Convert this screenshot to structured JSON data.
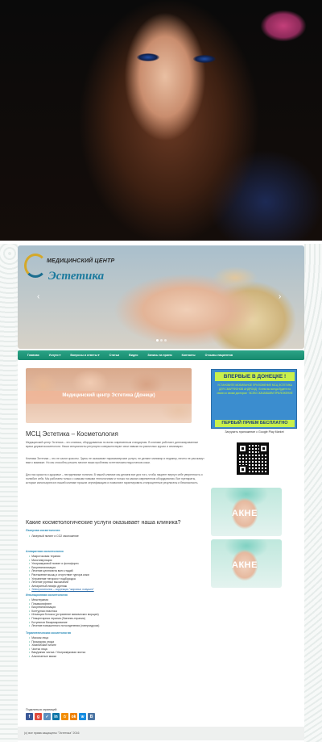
{
  "site": {
    "logo_small": "МЕДИЦИНСКИЙ ЦЕНТР",
    "logo_big": "Эстетика",
    "slider_prev": "‹",
    "slider_next": "›"
  },
  "nav": [
    "Главная",
    "Услуги ▾",
    "Вопросы и ответы ▾",
    "Статьи",
    "Видео",
    "Запись на прием",
    "Контакты",
    "Отзывы пациентов"
  ],
  "banner_text": "Медицинский центр Эстетика (Донецк)",
  "promo": {
    "top": "ВПЕРВЫЕ В ДОНЕЦКЕ !",
    "middle": "УСТАНОВИТЕ МОБИЛЬНОЕ ПРИЛОЖЕНИЕ МСЦ ЭСТЕТИКА ДЛЯ СМАРТФОНОВ АНДРОИД · В нем вы всегда будете на связи со своим доктором · ВСЕМ СКАЧАВШИМ ПРИЛОЖЕНИЕ",
    "bottom": "ПЕРВЫЙ ПРИЕМ БЕСПЛАТНО"
  },
  "app_text": "Загрузить приложение с Google Play Market",
  "acne_label": "АКНЕ",
  "main": {
    "title": "МСЦ Эстетика – Косметология",
    "para1": "Медицинский центр Эстетика – это клиника, оборудованная по всем современным стандартам. В клинике работают дипломированные врачи дерматокосметологи. Наши специалисты регулярно совершенствуют свои навыки на различных курсах и семинарах.",
    "para2": "Клиника Эстетика – это не салон красоты. Здесь не оказывают парикмахерские услуги, не делают маникюр и педикюр, ничего не расскажут вам о макияже. Но мы способны решить многие ваши проблемы эстетическим недостатком кожи.",
    "para3": "Для нас красота и здоровье – неотделимые понятия. В нашей клинике мы делаем все для того, чтобы пациент вернул себе уверенность и полюбил себя. Мы работаем только с самыми новыми технологиями и только на самом современном оборудовании. Все препараты, которые используются в нашей клинике прошли сертификацию и позволяют гарантировать стопроцентные результаты и безопасность.",
    "question": "Какие косметологические услуги оказывает наша клиника?"
  },
  "sections": [
    {
      "title": "Лазерная косметология",
      "items": [
        "Лазерный пилинг и CO2 омоложение"
      ]
    },
    {
      "title": "Аппаратная косметология",
      "items": [
        "Микротоковая терапия",
        "Миостимуляция",
        "Ультразвуковой пилинг и фонофорез",
        "Биоревитализация",
        "Лечение целлюлита всех стадий",
        "Растяжение мышц и отсутствие тургора кожи",
        "Устранение «второго» подбородка",
        "Лечение угревых высыпаний",
        "Аппаратный лимфо дренаж",
        "Электролиполиз – коррекция \"жировых ловушек\""
      ]
    },
    {
      "title": "Инъекционная косметология",
      "items": [
        "Мезотерапия",
        "Плазмолифтинг",
        "Биоревитализация",
        "Контурная пластика",
        "Инъекции ботокса (устранение мимических морщин)",
        "Плацентарная терапия (Лаеннек-терапия)",
        "Ботулинов биоармирование",
        "Лечение повышенного потоотделения (гипергидроза)"
      ]
    },
    {
      "title": "Терапевтическая косметология",
      "items": [
        "Массаж лица",
        "Процедуры ухода",
        "Химический пилинг",
        "Чистка лица",
        "Вакуумная чистка / Ультразвуковая чистка",
        "Альгинатные маски"
      ]
    }
  ],
  "share_label": "Поделиться страницей:",
  "share_icons": [
    {
      "label": "f",
      "color": "#3b5998"
    },
    {
      "label": "g",
      "color": "#e24a3b"
    },
    {
      "label": "✓",
      "color": "#5d8fbf"
    },
    {
      "label": "in",
      "color": "#0e76a8"
    },
    {
      "label": "☆",
      "color": "#f28c00"
    },
    {
      "label": "ok",
      "color": "#ee8208"
    },
    {
      "label": "ѡ",
      "color": "#168de2"
    },
    {
      "label": "B",
      "color": "#4c75a3"
    }
  ],
  "footer": "(с) все права защищены \"Эстетика\" 2016"
}
